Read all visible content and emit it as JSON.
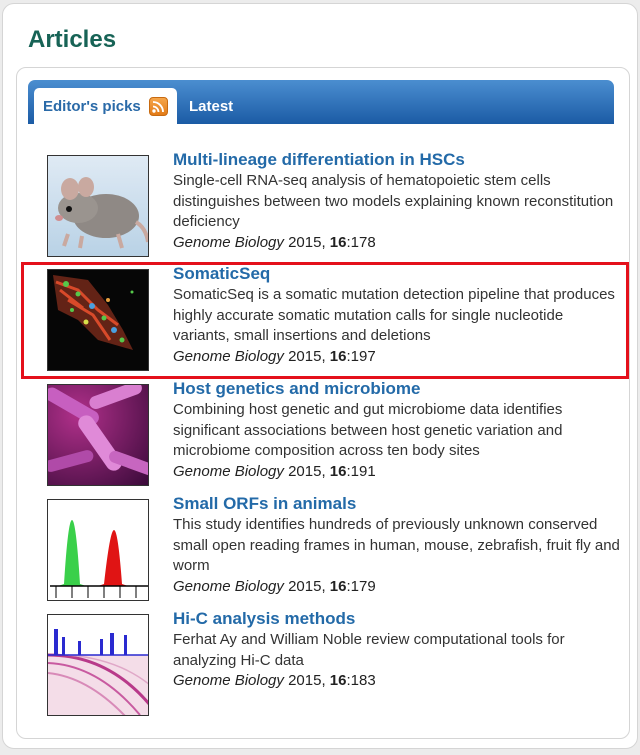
{
  "heading": "Articles",
  "tabs": {
    "editors_picks": "Editor's picks",
    "latest": "Latest"
  },
  "articles": [
    {
      "title": "Multi-lineage differentiation in HSCs",
      "description": "Single-cell RNA-seq analysis of hematopoietic stem cells distinguishes between two models explaining known reconstitution deficiency",
      "journal": "Genome Biology",
      "year": " 2015, ",
      "volume": "16",
      "page": ":178",
      "image": "mouse-thumbnail"
    },
    {
      "title": "SomaticSeq",
      "description": "SomaticSeq is a somatic mutation detection pipeline that produces highly accurate somatic mutation calls for single nucleotide variants, small insertions and deletions",
      "journal": "Genome Biology",
      "year": " 2015, ",
      "volume": "16",
      "page": ":197",
      "image": "cell-microscopy-thumbnail"
    },
    {
      "title": "Host genetics and microbiome",
      "description": "Combining host genetic and gut microbiome data identifies significant associations between host genetic variation and microbiome composition across ten body sites",
      "journal": "Genome Biology",
      "year": " 2015, ",
      "volume": "16",
      "page": ":191",
      "image": "bacteria-thumbnail"
    },
    {
      "title": "Small ORFs in animals",
      "description": "This study identifies hundreds of previously unknown conserved small open reading frames in human, mouse, zebrafish, fruit fly and worm",
      "journal": "Genome Biology",
      "year": " 2015, ",
      "volume": "16",
      "page": ":179",
      "image": "peaks-plot-thumbnail"
    },
    {
      "title": "Hi-C analysis methods",
      "description": "Ferhat Ay and William Noble review computational tools for analyzing Hi-C data",
      "journal": "Genome Biology",
      "year": " 2015, ",
      "volume": "16",
      "page": ":183",
      "image": "hic-map-thumbnail"
    }
  ],
  "colors": {
    "heading": "#176356",
    "link": "#236aa8",
    "tabbar": "#1b5ba5",
    "highlight": "#e4101b"
  },
  "icons": {
    "rss": "rss-feed-icon"
  }
}
